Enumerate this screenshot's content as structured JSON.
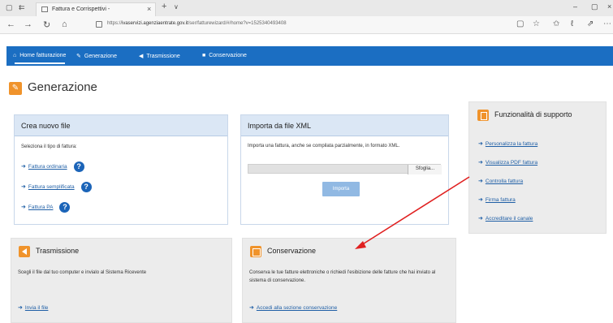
{
  "browser": {
    "tab_title": "Fattura e Corrispettivi -",
    "tab_close": "×",
    "new_tab": "+",
    "tab_menu": "∨",
    "win_minimize": "–",
    "win_maximize": "▢",
    "win_close": "×",
    "back": "←",
    "forward": "→",
    "reload": "↻",
    "home": "⌂",
    "url_prefix": "https://",
    "url_host": "ivaservizi.agenziaentrate.gov.it",
    "url_path": "/ser/fatturewizard/#/home?v=1525340493408",
    "toolbar_icons": [
      "▢",
      "☆",
      "✩",
      "ℓ",
      "⇗",
      "⋯"
    ]
  },
  "sitenav": {
    "items": [
      {
        "icon": "⌂",
        "label": "Home fatturazione"
      },
      {
        "icon": "✎",
        "label": "Generazione"
      },
      {
        "icon": "◀",
        "label": "Trasmissione"
      },
      {
        "icon": "■",
        "label": "Conservazione"
      }
    ]
  },
  "page": {
    "title_icon": "✎",
    "title": "Generazione"
  },
  "crea": {
    "title": "Crea nuovo file",
    "prompt": "Seleziona il tipo di fattura:",
    "arrow": "➜",
    "help": "?",
    "links": [
      "Fattura ordinaria",
      "Fattura semplificata",
      "Fattura PA"
    ]
  },
  "importa": {
    "title": "Importa da file XML",
    "text": "Importa una fattura, anche se compilata parzialmente, in formato XML.",
    "browse": "Sfoglia...",
    "import_button": "Importa"
  },
  "supporto": {
    "title": "Funzionalità di supporto",
    "arrow": "➜",
    "links": [
      "Personalizza la fattura",
      "Visualizza PDF fattura",
      "Controlla fattura",
      "Firma fattura",
      "Accreditare il canale"
    ]
  },
  "trasmissione": {
    "title": "Trasmissione",
    "text": "Scegli il file dal tuo computer e invialo al Sistema Ricevente",
    "arrow": "➜",
    "link": "Invia il file"
  },
  "conservazione": {
    "title": "Conservazione",
    "text": "Conserva le tue fatture elettroniche o richiedi l'esibizione delle fatture che hai inviato al sistema di conservazione.",
    "arrow": "➜",
    "link": "Accedi alla sezione conservazione"
  },
  "colors": {
    "nav_blue": "#1b6ec2",
    "accent_orange": "#f0932b",
    "annotation_red": "#e02020",
    "link_blue": "#1f5fa6"
  }
}
